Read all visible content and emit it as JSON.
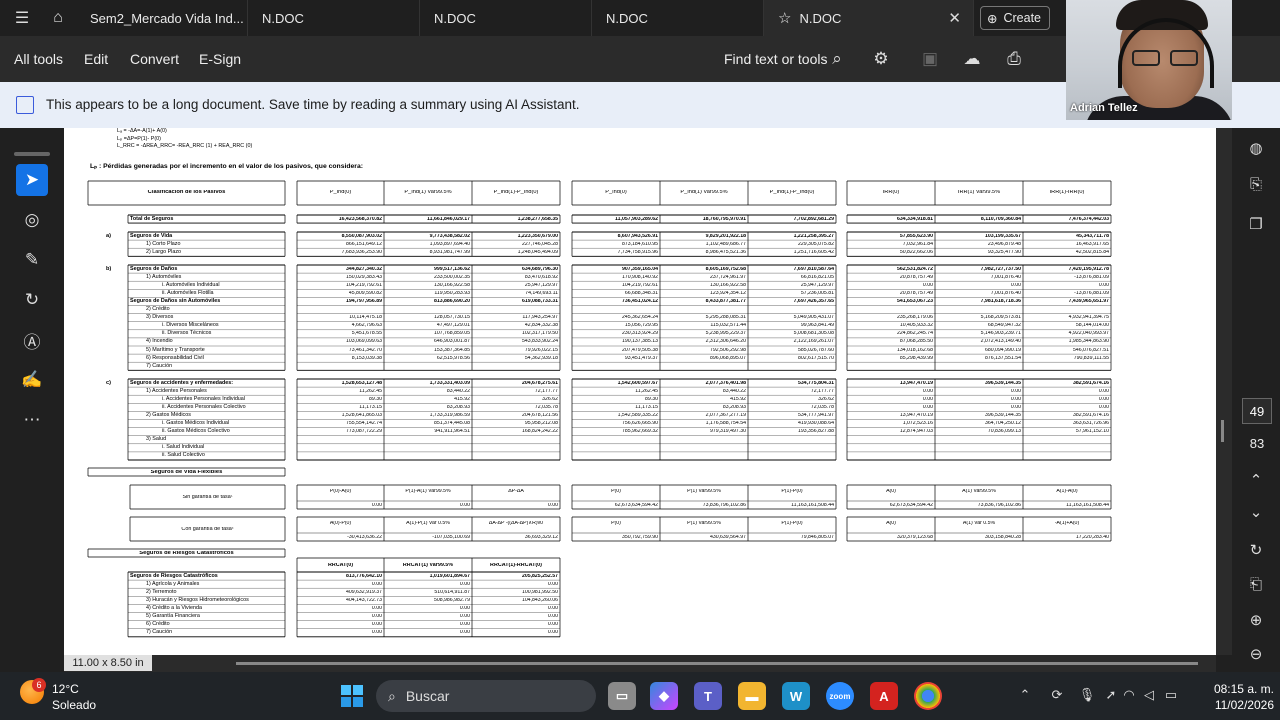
{
  "tabs": [
    {
      "label": "Sem2_Mercado Vida Ind..."
    },
    {
      "label": "N.DOC"
    },
    {
      "label": "N.DOC"
    },
    {
      "label": "N.DOC"
    },
    {
      "label": "N.DOC"
    }
  ],
  "create_label": "Create",
  "toolbar": {
    "all_tools": "All tools",
    "edit": "Edit",
    "convert": "Convert",
    "esign": "E-Sign",
    "find": "Find text or tools"
  },
  "banner": {
    "text": "This appears to be a long document. Save time by reading a summary using AI Assistant."
  },
  "webcam": {
    "name": "Adrian Tellez"
  },
  "page_number": "49",
  "page_total": "83",
  "page_size": "11.00 x 8.50 in",
  "colors": {
    "accent": "#1473e6",
    "banner_bg": "#e8eef8",
    "dark_bg": "#2b2b2b"
  },
  "doc": {
    "formula_lines": [
      "Lₐ = -ΔA=-A(1)+ A(0)",
      "Lₚ =ΔP=P(1)- P(0)",
      "L_RRC = -ΔREA_RRC= -REA_RRC (1) + REA_RRC (0)"
    ],
    "lp_title": "Lₚ : Pérdidas generadas por el incremento en el valor de los pasivos, que considera:",
    "header": {
      "clasif": "Clasificación de los Pasivos",
      "cols": [
        "P_Ind(0)",
        "P_Ind(1) Var99.5%",
        "P_Ind(1)-P_Ind(0)",
        "P_Ind(0)",
        "P_Ind(1) Var99.5%",
        "P_Ind(1)-P_Ind(0)",
        "IRR(0)",
        "IRR(1) Var99.5%",
        "IRR(1)-IRR(0)"
      ]
    },
    "rows": [
      {
        "label": "Total de Seguros",
        "bold": true,
        "v": [
          "16,423,568,370.82",
          "11,661,846,029.17",
          "1,238,277,658.35",
          "11,057,903,289.62",
          "18,760,795,970.91",
          "7,702,892,681.29",
          "634,334,918.81",
          "8,110,709,360.84",
          "7,476,374,442.03"
        ]
      },
      {
        "letter": "a)",
        "label": "Seguros de Vida",
        "bold": true,
        "v": [
          "8,550,087,903.02",
          "9,773,438,582.02",
          "1,223,350,679.00",
          "8,607,943,526.91",
          "9,829,201,922.18",
          "1,221,258,395.27",
          "57,855,623.90",
          "103,199,335.67",
          "45,343,711.78"
        ]
      },
      {
        "label": "1) Corto Plazo",
        "indent": 1,
        "v": [
          "866,151,649.12",
          "1,093,897,694.40",
          "227,746,045.28",
          "873,184,610.95",
          "1,102,489,686.77",
          "229,305,075.82",
          "7,032,961.84",
          "23,496,879.48",
          "16,463,917.65"
        ]
      },
      {
        "label": "2) Largo Plazo",
        "indent": 1,
        "v": [
          "7,683,936,253.90",
          "8,931,981,747.99",
          "1,248,045,494.09",
          "7,734,758,915.96",
          "8,986,475,521.36",
          "1,251,716,605.42",
          "50,822,662.06",
          "93,325,477.90",
          "42,502,815.84"
        ]
      },
      {
        "letter": "b)",
        "label": "Seguros de Daños",
        "bold": true,
        "v": [
          "344,827,340.32",
          "999,517,136.62",
          "634,689,796.30",
          "907,359,165.04",
          "8,605,169,752.68",
          "7,697,810,587.64",
          "562,531,824.72",
          "7,982,727,737.50",
          "7,420,195,912.78"
        ]
      },
      {
        "label": "1) Automóviles",
        "indent": 1,
        "v": [
          "150,029,383.43",
          "233,500,002.35",
          "83,470,618.92",
          "170,908,140.92",
          "237,724,961.97",
          "66,816,821.05",
          "20,878,757.49",
          "7,001,876.40",
          "-13,876,881.09"
        ]
      },
      {
        "label": "i. Automóviles Individual",
        "indent": 2,
        "v": [
          "104,219,792.61",
          "130,166,922.58",
          "25,947,129.97",
          "104,219,792.61",
          "130,166,922.58",
          "25,947,129.97",
          "0.00",
          "0.00",
          "0.00"
        ]
      },
      {
        "label": "ii. Automóviles Flotilla",
        "indent": 2,
        "v": [
          "45,809,590.82",
          "119,950,283.93",
          "74,149,693.11",
          "66,688,348.31",
          "123,924,354.12",
          "57,236,005.81",
          "20,878,757.49",
          "7,001,876.40",
          "-13,876,881.09"
        ]
      },
      {
        "label": "Seguros de Daños sin Automóviles",
        "bold": true,
        "v": [
          "194,797,956.89",
          "813,886,690.20",
          "619,088,733.31",
          "736,451,024.12",
          "8,433,877,381.77",
          "7,697,426,357.65",
          "541,653,067.23",
          "7,981,618,718.36",
          "7,439,965,651.97"
        ]
      },
      {
        "label": "2) Crédito",
        "indent": 1,
        "v": [
          "",
          "",
          "",
          "",
          "",
          "",
          "",
          "",
          ""
        ]
      },
      {
        "label": "3) Diversos",
        "indent": 1,
        "v": [
          "10,114,475.18",
          "128,057,730.15",
          "117,943,254.97",
          "245,362,654.24",
          "5,295,288,085.31",
          "5,049,905,431.07",
          "235,268,179.06",
          "5,168,209,573.81",
          "4,932,941,394.75"
        ]
      },
      {
        "label": "i. Diversos Misceláneos",
        "indent": 2,
        "v": [
          "4,662,796.63",
          "47,497,129.01",
          "42,834,332.38",
          "15,056,729.95",
          "115,032,571.44",
          "99,963,841.49",
          "10,405,933.32",
          "68,549,947.32",
          "58,144,014.00"
        ]
      },
      {
        "label": "ii. Diversos Técnicos",
        "indent": 2,
        "v": [
          "5,451,678.55",
          "107,768,859.05",
          "102,317,179.50",
          "230,313,924.29",
          "5,238,995,229.37",
          "5,008,681,305.08",
          "224,862,245.74",
          "5,146,903,239.71",
          "4,922,040,993.97"
        ]
      },
      {
        "label": "4) Incendio",
        "indent": 1,
        "v": [
          "103,069,099.63",
          "646,903,001.87",
          "543,833,902.24",
          "190,137,385.13",
          "2,312,306,646.20",
          "2,122,169,261.07",
          "87,068,285.50",
          "2,072,413,149.40",
          "1,985,344,863.90"
        ]
      },
      {
        "label": "5) Marítimo y Transporte",
        "indent": 1,
        "v": [
          "73,461,342.70",
          "153,387,364.85",
          "79,926,022.15",
          "207,479,505.38",
          "792,506,292.98",
          "585,026,787.60",
          "134,018,162.68",
          "680,094,990.19",
          "546,076,827.51"
        ]
      },
      {
        "label": "6) Responsabilidad Civil",
        "indent": 1,
        "v": [
          "8,153,039.38",
          "62,515,978.56",
          "54,362,939.18",
          "93,451,479.37",
          "896,068,895.07",
          "802,617,515.70",
          "85,298,439.99",
          "876,137,551.54",
          "790,839,111.55"
        ]
      },
      {
        "label": "7) Caución",
        "indent": 1,
        "v": [
          "",
          "",
          "",
          "",
          "",
          "",
          "",
          "",
          ""
        ]
      },
      {
        "letter": "c)",
        "label": "Seguros de accidentes y enfermedades:",
        "bold": true,
        "v": [
          "1,528,653,127.48",
          "1,733,331,403.09",
          "204,678,275.61",
          "1,542,600,597.67",
          "2,077,376,401.98",
          "534,775,804.31",
          "13,947,470.19",
          "396,539,144.35",
          "382,591,674.16"
        ]
      },
      {
        "label": "1) Accidentes Personales",
        "indent": 1,
        "v": [
          "11,262.45",
          "83,440.22",
          "72,177.77",
          "11,262.45",
          "83,440.22",
          "72,177.77",
          "0.00",
          "0.00",
          "0.00"
        ]
      },
      {
        "label": "i. Accidentes Personales Individual",
        "indent": 2,
        "v": [
          "89.30",
          "415.92",
          "326.62",
          "89.30",
          "415.92",
          "326.62",
          "0.00",
          "0.00",
          "0.00"
        ]
      },
      {
        "label": "ii. Accidentes Personales Colectivo",
        "indent": 2,
        "v": [
          "11,173.15",
          "83,208.93",
          "72,035.78",
          "11,173.15",
          "83,208.93",
          "72,035.78",
          "0.00",
          "0.00",
          "0.00"
        ]
      },
      {
        "label": "2) Gastos Médicos",
        "indent": 1,
        "v": [
          "1,528,641,865.03",
          "1,733,319,986.59",
          "204,678,121.56",
          "1,542,589,335.22",
          "2,077,367,277.19",
          "534,777,941.97",
          "13,947,470.19",
          "396,539,144.35",
          "382,591,674.16"
        ]
      },
      {
        "label": "i. Gastos Médicos Individual",
        "indent": 2,
        "v": [
          "755,554,142.74",
          "851,374,445.08",
          "95,958,212.08",
          "756,626,665.90",
          "1,176,588,754.54",
          "419,930,088.64",
          "1,072,523.16",
          "364,704,250.12",
          "363,631,726.96"
        ]
      },
      {
        "label": "ii. Gastos Médicos Colectivo",
        "indent": 2,
        "v": [
          "773,087,722.29",
          "941,911,964.51",
          "168,824,242.22",
          "785,962,669.32",
          "979,319,497.30",
          "193,356,827.88",
          "12,874,947.03",
          "70,836,099.13",
          "57,961,152.10"
        ]
      },
      {
        "label": "3) Salud",
        "indent": 1,
        "v": [
          "",
          "",
          "",
          "",
          "",
          "",
          "",
          "",
          ""
        ]
      },
      {
        "label": "i. Salud Individual",
        "indent": 2,
        "v": [
          "",
          "",
          "",
          "",
          "",
          "",
          "",
          "",
          ""
        ]
      },
      {
        "label": "ii. Salud Colectivo",
        "indent": 2,
        "v": [
          "",
          "",
          "",
          "",
          "",
          "",
          "",
          "",
          ""
        ]
      }
    ],
    "flex": {
      "title": "Seguros de Vida Flexibles",
      "sin": {
        "label": "Sin garantía de tasa¹",
        "heads": [
          "P(0)-A(0)",
          "P(1)-A(1) Var99.5%",
          "ΔP-ΔA",
          "P(0)",
          "P(1) Var99.5%",
          "P(1)-P(0)",
          "A(0)",
          "A(1) Var99.5%",
          "A(1)-A(0)"
        ],
        "vals": [
          "0.00",
          "0.00",
          "0.00",
          "62,673,634,594.42",
          "73,836,796,102.86",
          "11,163,161,508.44",
          "62,673,634,594.42",
          "73,836,796,102.86",
          "11,163,161,508.44"
        ]
      },
      "con": {
        "label": "Con garantía de tasa²",
        "heads": [
          "A(0)-P(0)",
          "A(1)-P(1) Var 0.5%",
          "ΔA-ΔP -((ΔA-ΔP)∧R)v0",
          "P(0)",
          "P(1) Var99.5%",
          "P(1)-P(0)",
          "A(0)",
          "A(1) Var 0.5%",
          "-A(1)+A(0)"
        ],
        "vals": [
          "-30,413,636.22",
          "-107,035,100.69",
          "36,693,329.12",
          "350,792,759.90",
          "430,639,564.97",
          "79,846,805.07",
          "320,379,123.68",
          "303,158,840.28",
          "17,220,283.40"
        ]
      }
    },
    "cat": {
      "title": "Seguros de Riesgos Catastróficos",
      "heads": [
        "RRCAT(0)",
        "RRCAT(1) Var99.5%",
        "RRCAT(1)-RRCAT(0)"
      ],
      "rows": [
        {
          "label": "Seguros de Riesgos Catastróficos",
          "bold": true,
          "v": [
            "813,776,642.10",
            "1,019,601,894.67",
            "205,825,252.57"
          ]
        },
        {
          "label": "1) Agrícola y Animales",
          "indent": 1,
          "v": [
            "0.00",
            "0.00",
            "0.00"
          ]
        },
        {
          "label": "2) Terremoto",
          "indent": 1,
          "v": [
            "409,632,919.37",
            "510,614,911.87",
            "100,981,992.50"
          ]
        },
        {
          "label": "3) Huracán y Riesgos Hidrometeorológicos",
          "indent": 1,
          "v": [
            "404,143,722.73",
            "508,986,982.79",
            "104,843,260.06"
          ]
        },
        {
          "label": "4) Crédito a la Vivienda",
          "indent": 1,
          "v": [
            "0.00",
            "0.00",
            "0.00"
          ]
        },
        {
          "label": "5) Garantía Financiera",
          "indent": 1,
          "v": [
            "0.00",
            "0.00",
            "0.00"
          ]
        },
        {
          "label": "6) Crédito",
          "indent": 1,
          "v": [
            "0.00",
            "0.00",
            "0.00"
          ]
        },
        {
          "label": "7) Caución",
          "indent": 1,
          "v": [
            "0.00",
            "0.00",
            "0.00"
          ]
        }
      ]
    }
  },
  "weather": {
    "temp": "12°C",
    "desc": "Soleado",
    "badge": "6"
  },
  "taskbar": {
    "search": "Buscar"
  },
  "clock": {
    "time": "08:15 a. m.",
    "date": "11/02/2026"
  }
}
